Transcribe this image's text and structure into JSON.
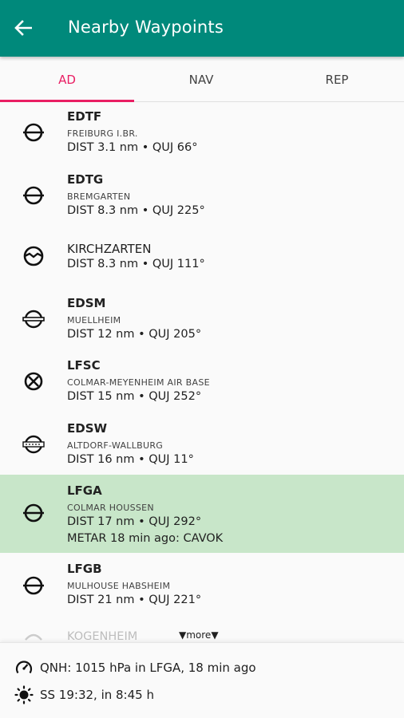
{
  "appbar": {
    "title": "Nearby Waypoints",
    "back_icon": "arrow-back-icon"
  },
  "tabs": [
    {
      "label": "AD",
      "active": true
    },
    {
      "label": "NAV",
      "active": false
    },
    {
      "label": "REP",
      "active": false
    }
  ],
  "colors": {
    "primary": "#00897b",
    "accent": "#e91e63",
    "highlight": "#c8e6c9"
  },
  "waypoints": [
    {
      "ident": "EDTF",
      "name": "FREIBURG I.BR.",
      "dist": "DIST 3.1 nm • QUJ 66°",
      "icon": "airfield-icon"
    },
    {
      "ident": "EDTG",
      "name": "BREMGARTEN",
      "dist": "DIST 8.3 nm • QUJ 225°",
      "icon": "airfield-icon"
    },
    {
      "ident": "",
      "name": "KIRCHZARTEN",
      "dist": "DIST 8.3 nm • QUJ 111°",
      "icon": "glider-site-icon"
    },
    {
      "ident": "EDSM",
      "name": "MUELLHEIM",
      "dist": "DIST 12 nm • QUJ 205°",
      "icon": "airfield-paved-icon"
    },
    {
      "ident": "LFSC",
      "name": "COLMAR-MEYENHEIM AIR BASE",
      "dist": "DIST 15 nm • QUJ 252°",
      "icon": "military-airbase-icon"
    },
    {
      "ident": "EDSW",
      "name": "ALTDORF-WALLBURG",
      "dist": "DIST 16 nm • QUJ 11°",
      "icon": "airfield-grass-icon"
    },
    {
      "ident": "LFGA",
      "name": "COLMAR HOUSSEN",
      "dist": "DIST 17 nm • QUJ 292°",
      "metar": "METAR 18 min ago: CAVOK",
      "icon": "airfield-icon"
    },
    {
      "ident": "LFGB",
      "name": "MULHOUSE HABSHEIM",
      "dist": "DIST 21 nm • QUJ 221°",
      "icon": "airfield-icon"
    }
  ],
  "partial_item": {
    "name": "KOGENHEIM",
    "more_label": "▼more▼"
  },
  "footer": {
    "qnh": "QNH: 1015 hPa in LFGA, 18 min ago",
    "sunset": "SS 19:32, in 8:45 h"
  }
}
